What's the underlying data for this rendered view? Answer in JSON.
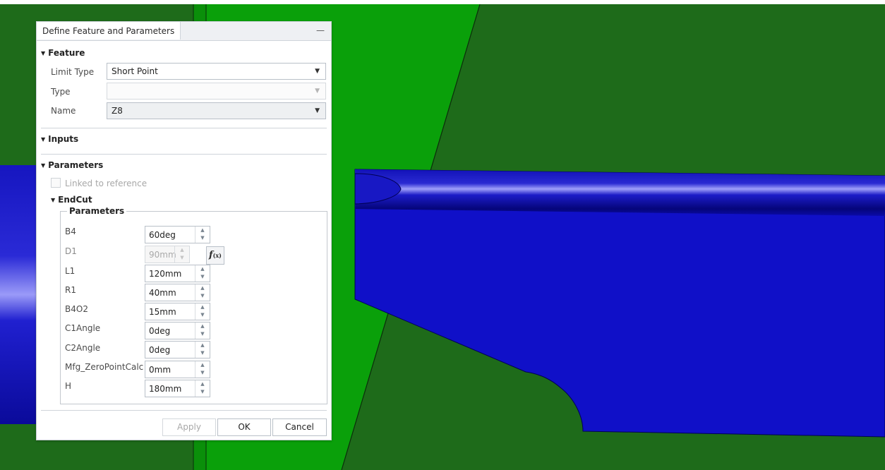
{
  "dialog": {
    "title": "Define Feature and Parameters",
    "minimize_glyph": "—"
  },
  "feature": {
    "heading": "Feature",
    "limit_type": {
      "label": "Limit Type",
      "value": "Short Point"
    },
    "type": {
      "label": "Type",
      "value": ""
    },
    "name": {
      "label": "Name",
      "value": "Z8"
    }
  },
  "inputs": {
    "heading": "Inputs"
  },
  "parameters": {
    "heading": "Parameters",
    "linked_to_reference": {
      "label": "Linked to reference",
      "checked": false,
      "enabled": false
    },
    "endcut": {
      "heading": "EndCut",
      "group_title": "Parameters",
      "items": [
        {
          "name": "B4",
          "value": "60deg",
          "enabled": true
        },
        {
          "name": "D1",
          "value": "90mm",
          "enabled": false,
          "has_formula": true
        },
        {
          "name": "L1",
          "value": "120mm",
          "enabled": true
        },
        {
          "name": "R1",
          "value": "40mm",
          "enabled": true
        },
        {
          "name": "B4O2",
          "value": "15mm",
          "enabled": true
        },
        {
          "name": "C1Angle",
          "value": "0deg",
          "enabled": true
        },
        {
          "name": "C2Angle",
          "value": "0deg",
          "enabled": true
        },
        {
          "name": "Mfg_ZeroPointCalc",
          "value": "0mm",
          "enabled": true
        },
        {
          "name": "H",
          "value": "180mm",
          "enabled": true
        }
      ]
    }
  },
  "buttons": {
    "apply": "Apply",
    "ok": "OK",
    "cancel": "Cancel"
  },
  "icons": {
    "section_expanded": "triangle-down-icon",
    "dropdown": "dropdown-arrow-icon",
    "spinner": "spinner-arrows-icon",
    "formula": "formula-fx-icon"
  },
  "colors": {
    "plate_dark_green": "#1e6b1a",
    "plate_bright_green": "#0aa00a",
    "profile_blue": "#1010c8",
    "profile_highlight": "#8c8cf5"
  }
}
